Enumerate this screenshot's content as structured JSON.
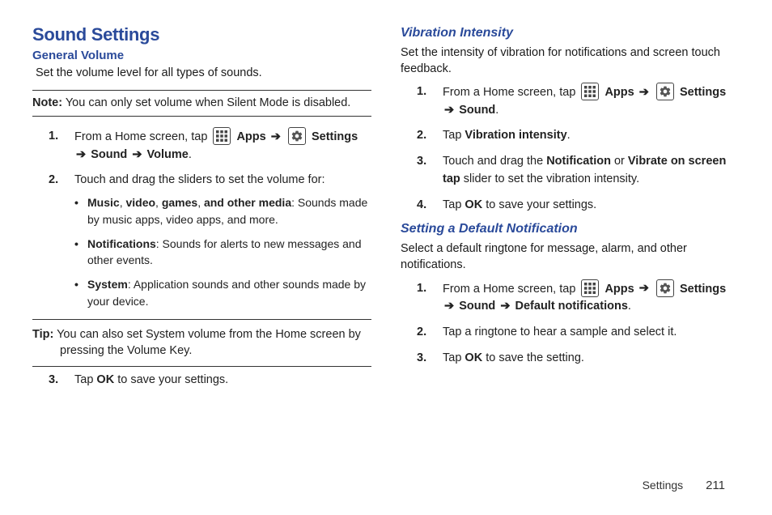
{
  "left": {
    "title": "Sound Settings",
    "generalVolume": {
      "heading": "General Volume",
      "intro": "Set the volume level for all types of sounds.",
      "noteLabel": "Note:",
      "noteText": " You can only set volume when Silent Mode is disabled.",
      "step1_a": "From a Home screen, tap ",
      "apps": "Apps",
      "arrow": "➔",
      "settings": "Settings",
      "step1_b": "Sound",
      "step1_c": "Volume",
      "step2": "Touch and drag the sliders to set the volume for:",
      "bullet1_b": "Music",
      "bullet1_sep1": ", ",
      "bullet1_b2": "video",
      "bullet1_sep2": ", ",
      "bullet1_b3": "games",
      "bullet1_sep3": ", ",
      "bullet1_b4": "and other media",
      "bullet1_tail": ": Sounds made by music apps, video apps, and more.",
      "bullet2_b": "Notifications",
      "bullet2_tail": ": Sounds for alerts to new messages and other events.",
      "bullet3_b": "System",
      "bullet3_tail": ": Application sounds and other sounds made by your device.",
      "tipLabel": "Tip:",
      "tipText": " You can also set System volume from the Home screen by pressing the Volume Key.",
      "step3_a": "Tap ",
      "step3_ok": "OK",
      "step3_b": " to save your settings."
    }
  },
  "right": {
    "vibration": {
      "heading": "Vibration Intensity",
      "intro": "Set the intensity of vibration for notifications and screen touch feedback.",
      "step1_a": "From a Home screen, tap ",
      "apps": "Apps",
      "arrow": "➔",
      "settings": "Settings",
      "step1_b": "Sound",
      "step2_a": "Tap ",
      "step2_b": "Vibration intensity",
      "step3_a": "Touch and drag the ",
      "step3_b": "Notification",
      "step3_or": " or ",
      "step3_c": "Vibrate on screen tap",
      "step3_d": " slider to set the vibration intensity.",
      "step4_a": "Tap ",
      "step4_ok": "OK",
      "step4_b": " to save your settings."
    },
    "defaultNotif": {
      "heading": "Setting a Default Notification",
      "intro": "Select a default ringtone for message, alarm, and other notifications.",
      "step1_a": "From a Home screen, tap ",
      "apps": "Apps",
      "arrow": "➔",
      "settings": "Settings",
      "step1_b": "Sound",
      "step1_c": "Default notifications",
      "step2": "Tap a ringtone to hear a sample and select it.",
      "step3_a": "Tap ",
      "step3_ok": "OK",
      "step3_b": " to save the setting."
    }
  },
  "footer": {
    "section": "Settings",
    "page": "211"
  }
}
